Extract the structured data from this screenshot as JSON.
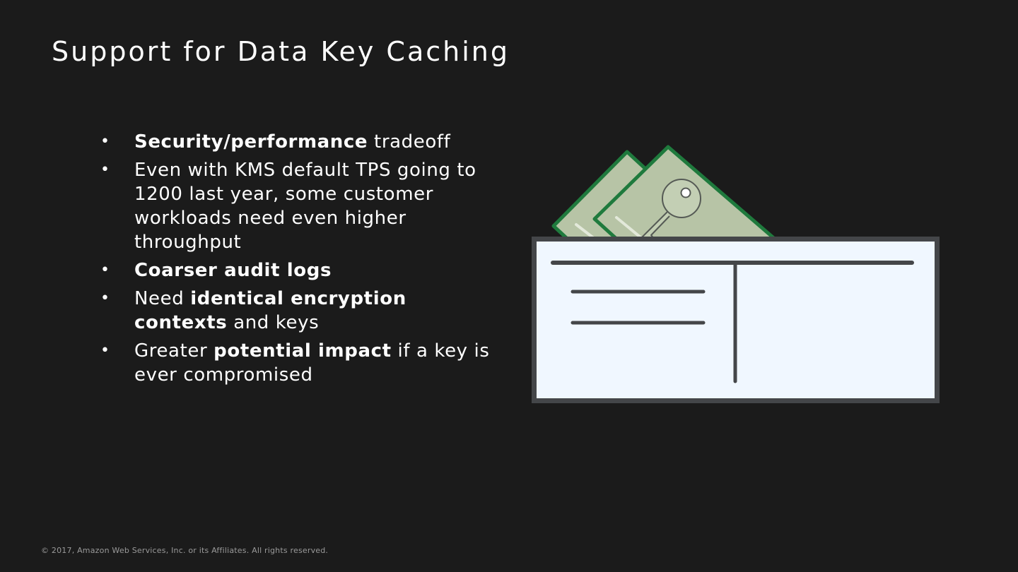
{
  "slide": {
    "title": "Support for Data Key Caching"
  },
  "bullets": [
    {
      "pre": "",
      "bold": "Security/performance",
      "post": " tradeoff"
    },
    {
      "pre": "Even with KMS default TPS going to 1200 last  year, some customer workloads need even higher throughput",
      "bold": "",
      "post": ""
    },
    {
      "pre": "",
      "bold": "Coarser audit logs",
      "post": ""
    },
    {
      "pre": "Need ",
      "bold": "identical encryption contexts",
      "post": " and keys"
    },
    {
      "pre": "Greater ",
      "bold": "potential impact",
      "post": " if a key is ever compromised"
    }
  ],
  "bullet_marker": "•",
  "illustration": {
    "icons": [
      "wallet-icon",
      "key-card-icon",
      "key-icon"
    ],
    "colors": {
      "card_fill": "#b7c4a6",
      "card_stroke": "#1f7a3d",
      "wallet_fill": "#f0f7ff",
      "wallet_stroke": "#444649"
    }
  },
  "footer": {
    "copyright": "© 2017, Amazon Web Services, Inc. or its Affiliates. All rights reserved."
  }
}
